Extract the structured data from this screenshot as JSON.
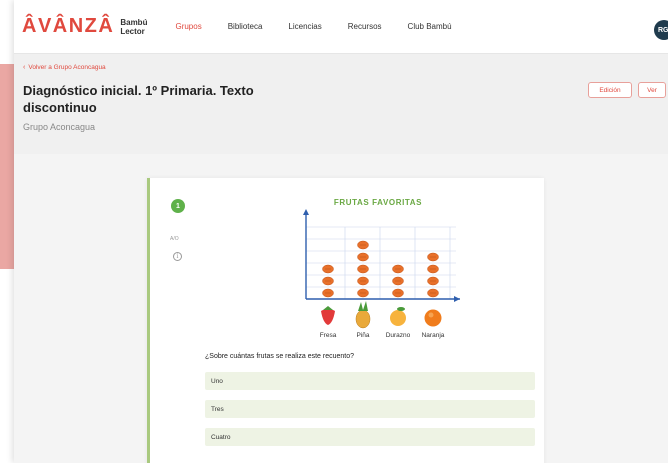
{
  "brand": {
    "name": "ÂVÂNZÂ",
    "sub_line1": "Bambú",
    "sub_line2": "Lector"
  },
  "nav": {
    "items": [
      {
        "label": "Grupos",
        "active": true
      },
      {
        "label": "Biblioteca",
        "active": false
      },
      {
        "label": "Licencias",
        "active": false
      },
      {
        "label": "Recursos",
        "active": false
      },
      {
        "label": "Club Bambú",
        "active": false
      }
    ],
    "avatar_initials": "RG"
  },
  "header": {
    "back_link": "Volver a Grupo Aconcagua",
    "title": "Diagnóstico inicial. 1º Primaria. Texto discontinuo",
    "group": "Grupo Aconcagua",
    "edit_button": "Edición",
    "view_button": "Ver"
  },
  "question_card": {
    "number": "1",
    "side_label": "A/O",
    "info_icon": "info-icon",
    "prompt": "¿Sobre cuántas frutas se realiza este recuento?",
    "options": [
      "Uno",
      "Tres",
      "Cuatro"
    ]
  },
  "chart_data": {
    "type": "pictograph",
    "title": "FRUTAS FAVORITAS",
    "categories": [
      "Fresa",
      "Piña",
      "Durazno",
      "Naranja"
    ],
    "values": [
      3,
      5,
      3,
      4
    ],
    "icons": [
      "strawberry-icon",
      "pineapple-icon",
      "peach-icon",
      "orange-icon"
    ],
    "marker_color": "#e8702a",
    "axis_color": "#2f5fae",
    "title_color": "#6aa843"
  },
  "colors": {
    "brand_red": "#e0493e",
    "accent_green": "#5fb14a",
    "option_bg": "#eef3e4",
    "avatar_bg": "#1f3b4d"
  }
}
